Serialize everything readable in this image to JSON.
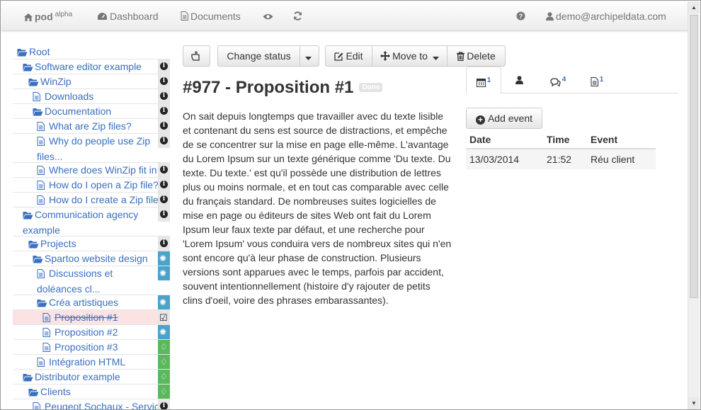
{
  "navbar": {
    "brand": "pod",
    "brand_sup": "alpha",
    "dashboard": "Dashboard",
    "documents": "Documents",
    "user": "demo@archipeldata.com"
  },
  "tree": [
    {
      "label": "Root",
      "icon": "folder-open-icon",
      "badge": ""
    },
    {
      "label": "Software editor example",
      "icon": "folder-open-icon",
      "badge": "info"
    },
    {
      "label": "WinZip",
      "icon": "folder-open-icon",
      "badge": "info"
    },
    {
      "label": "Downloads",
      "icon": "file-icon",
      "badge": "info"
    },
    {
      "label": "Documentation",
      "icon": "folder-open-icon",
      "badge": "info"
    },
    {
      "label": "What are Zip files?",
      "icon": "file-icon",
      "badge": "info"
    },
    {
      "label": "Why do people use Zip files...",
      "icon": "file-icon",
      "badge": "info"
    },
    {
      "label": "Where does WinZip fit in",
      "icon": "file-icon",
      "badge": "info"
    },
    {
      "label": "How do I open a Zip file?",
      "icon": "file-icon",
      "badge": "info"
    },
    {
      "label": "How do I create a Zip file",
      "icon": "file-icon",
      "badge": "info"
    },
    {
      "label": "Communication agency example",
      "icon": "folder-open-icon",
      "badge": "info"
    },
    {
      "label": "Projects",
      "icon": "folder-open-icon",
      "badge": "info"
    },
    {
      "label": "Spartoo website design",
      "icon": "folder-open-icon",
      "badge": "net"
    },
    {
      "label": "Discussions et doléances cl...",
      "icon": "file-icon",
      "badge": "net"
    },
    {
      "label": "Créa artistiques",
      "icon": "folder-open-icon",
      "badge": "net"
    },
    {
      "label": "Proposition #1",
      "icon": "file-icon",
      "badge": "check"
    },
    {
      "label": "Proposition #2",
      "icon": "file-icon",
      "badge": "net"
    },
    {
      "label": "Proposition #3",
      "icon": "file-icon",
      "badge": "bulb"
    },
    {
      "label": "Intégration HTML",
      "icon": "file-icon",
      "badge": "bulb"
    },
    {
      "label": "Distributor example",
      "icon": "folder-open-icon",
      "badge": "bulb"
    },
    {
      "label": "Clients",
      "icon": "folder-open-icon",
      "badge": "bulb"
    },
    {
      "label": "Peugeot Sochaux - Servic",
      "icon": "file-icon",
      "badge": "info"
    }
  ],
  "toolbar": {
    "change_status": "Change status",
    "edit": "Edit",
    "move_to": "Move to",
    "delete": "Delete"
  },
  "document": {
    "title": "#977 - Proposition #1",
    "status": "Done",
    "body": "On sait depuis longtemps que travailler avec du texte lisible et contenant du sens est source de distractions, et empêche de se concentrer sur la mise en page elle-même. L'avantage du Lorem Ipsum sur un texte générique comme 'Du texte. Du texte. Du texte.' est qu'il possède une distribution de lettres plus ou moins normale, et en tout cas comparable avec celle du français standard. De nombreuses suites logicielles de mise en page ou éditeurs de sites Web ont fait du Lorem Ipsum leur faux texte par défaut, et une recherche pour 'Lorem Ipsum' vous conduira vers de nombreux sites qui n'en sont encore qu'à leur phase de construction. Plusieurs versions sont apparues avec le temps, parfois par accident, souvent intentionnellement (histoire d'y rajouter de petits clins d'oeil, voire des phrases embarassantes)."
  },
  "tabs": {
    "calendar_count": "1",
    "comments_count": "4",
    "files_count": "1"
  },
  "events": {
    "add_label": "Add event",
    "headers": [
      "Date",
      "Time",
      "Event"
    ],
    "rows": [
      [
        "13/03/2014",
        "21:52",
        "Réu client"
      ]
    ]
  }
}
